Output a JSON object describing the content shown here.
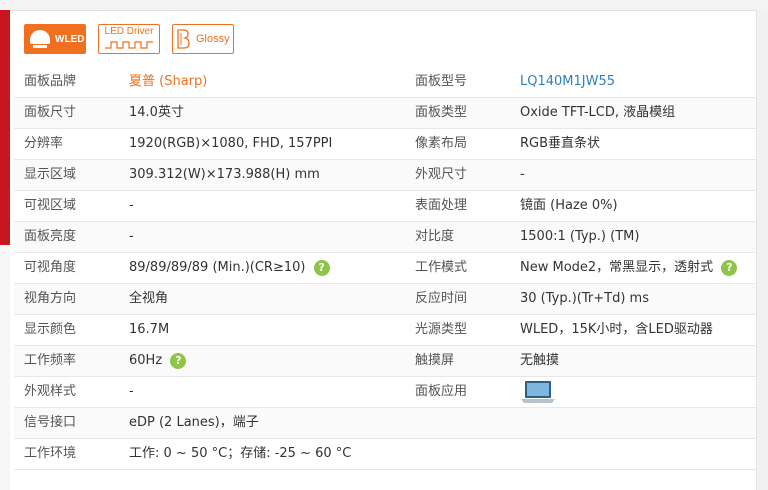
{
  "badges": {
    "wled": "WLED",
    "led_driver": "LED Driver",
    "glossy": "Glossy"
  },
  "specs": [
    {
      "label": "面板品牌",
      "value": "夏普 (Sharp)",
      "label2": "面板型号",
      "value2": "LQ140M1JW55"
    },
    {
      "label": "面板尺寸",
      "value": "14.0英寸",
      "label2": "面板类型",
      "value2": "Oxide TFT-LCD, 液晶模组"
    },
    {
      "label": "分辨率",
      "value": "1920(RGB)×1080, FHD, 157PPI",
      "label2": "像素布局",
      "value2": "RGB垂直条状"
    },
    {
      "label": "显示区域",
      "value": "309.312(W)×173.988(H) mm",
      "label2": "外观尺寸",
      "value2": "-"
    },
    {
      "label": "可视区域",
      "value": "-",
      "label2": "表面处理",
      "value2": "镜面 (Haze 0%)"
    },
    {
      "label": "面板亮度",
      "value": "-",
      "label2": "对比度",
      "value2": "1500:1 (Typ.) (TM)"
    },
    {
      "label": "可视角度",
      "value": "89/89/89/89 (Min.)(CR≥10)",
      "label2": "工作模式",
      "value2": "New Mode2，常黑显示，透射式"
    },
    {
      "label": "视角方向",
      "value": "全视角",
      "label2": "反应时间",
      "value2": "30 (Typ.)(Tr+Td) ms"
    },
    {
      "label": "显示颜色",
      "value": "16.7M",
      "label2": "光源类型",
      "value2": "WLED，15K小时，含LED驱动器"
    },
    {
      "label": "工作频率",
      "value": "60Hz",
      "label2": "触摸屏",
      "value2": "无触摸"
    },
    {
      "label": "外观样式",
      "value": "-",
      "label2": "面板应用",
      "value2": ""
    },
    {
      "label": "信号接口",
      "value": "eDP (2 Lanes)，端子"
    },
    {
      "label": "工作环境",
      "value": "工作: 0 ~ 50 °C；存储: -25 ~ 60 °C"
    }
  ],
  "help_icon": "?",
  "icons": {
    "help": "question-circle-icon",
    "application": "laptop-icon"
  },
  "colors": {
    "accent": "#f0701f",
    "link": "#2f7fbf",
    "help": "#8ec44a",
    "brand_red": "#c9161d"
  }
}
